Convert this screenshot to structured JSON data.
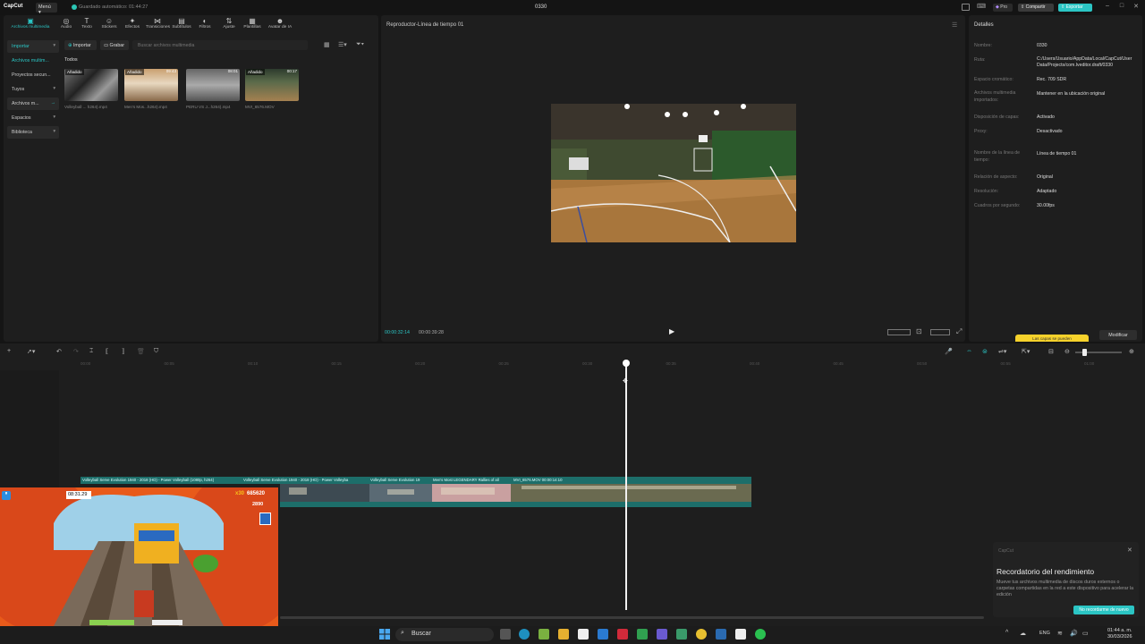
{
  "titlebar": {
    "logo": "CapCut",
    "menu": "Menú",
    "autosave": "Guardado automático: 01:44:27",
    "project_title": "0330",
    "pro": "Pro",
    "share": "Compartir",
    "export": "Exportar"
  },
  "media_panel": {
    "tools": [
      {
        "label": "Archivos multimedia",
        "icon": "media-icon"
      },
      {
        "label": "Audio",
        "icon": "audio-icon"
      },
      {
        "label": "Texto",
        "icon": "text-icon"
      },
      {
        "label": "Stickers",
        "icon": "sticker-icon"
      },
      {
        "label": "Efectos",
        "icon": "effects-icon"
      },
      {
        "label": "Transiciones",
        "icon": "transitions-icon"
      },
      {
        "label": "Subtítulos",
        "icon": "subtitles-icon"
      },
      {
        "label": "Filtros",
        "icon": "filters-icon"
      },
      {
        "label": "Ajuste",
        "icon": "adjust-icon"
      },
      {
        "label": "Plantillas",
        "icon": "templates-icon"
      },
      {
        "label": "Avatar de IA",
        "icon": "avatar-icon"
      }
    ],
    "nav": [
      {
        "label": "Importar"
      },
      {
        "label": "Archivos multim..."
      },
      {
        "label": "Proyectos secun..."
      },
      {
        "label": "Tuyos"
      },
      {
        "label": "Archivos m..."
      },
      {
        "label": "Espacios"
      },
      {
        "label": "Biblioteca"
      }
    ],
    "import_btn": "Importar",
    "record_btn": "Grabar",
    "search_placeholder": "Buscar archivos multimedia",
    "section_title": "Todos",
    "items": [
      {
        "badge": "Añadido",
        "duration": "",
        "name": "Volleyball ... h264).mp4"
      },
      {
        "badge": "Añadido",
        "duration": "09:43",
        "name": "Men's Mos...h264).mp4"
      },
      {
        "badge": "",
        "duration": "08:01",
        "name": "PERU VS J...h264).mp4"
      },
      {
        "badge": "Añadido",
        "duration": "00:17",
        "name": "MVI_6576.MOV"
      }
    ]
  },
  "player": {
    "title": "Reproductor-Línea de tiempo 01",
    "current_time": "00:00:32:14",
    "total_time": "00:00:39:28"
  },
  "details": {
    "title": "Detalles",
    "rows": [
      {
        "label": "Nombre:",
        "value": "0330"
      },
      {
        "label": "Ruta:",
        "value": "C:/Users/Usuario/AppData/Local/CapCut/User Data/Projects/com.lveditor.draft/0330"
      },
      {
        "label": "Espacio cromático:",
        "value": "Rec. 709 SDR"
      },
      {
        "label": "Archivos multimedia importados:",
        "value": "Mantener en la ubicación original"
      },
      {
        "label": "Disposición de capas:",
        "value": "Activado"
      },
      {
        "label": "Proxy:",
        "value": "Desactivado"
      },
      {
        "label": "Nombre de la línea de tiempo:",
        "value": "Línea de tiempo 01"
      },
      {
        "label": "Relación de aspecto:",
        "value": "Original"
      },
      {
        "label": "Resolución:",
        "value": "Adaptado"
      },
      {
        "label": "Cuadros por segundo:",
        "value": "30.00fps"
      }
    ],
    "tip": "Las capas se pueden",
    "modify": "Modificar"
  },
  "timeline": {
    "ticks": [
      "00:00",
      "00:05",
      "00:10",
      "00:15",
      "00:20",
      "00:25",
      "00:30",
      "00:35",
      "00:40",
      "00:45",
      "00:50",
      "00:55",
      "01:00",
      "01:05"
    ],
    "clips": [
      "Volleyball Serve Evolution 1940 - 2018 (HD) - Power Volleyball (1080p, h264)",
      "Volleyball Serve Evolution 1940 - 2018 (HD) - Power Volleyba",
      "Volleyball Serve Evolution 19",
      "Men's Most LEGENDARY Rallies of all",
      "MVI_6576.MOV   00:00:14:10"
    ]
  },
  "game": {
    "time": "08:31.29",
    "multiplier": "x30",
    "score": "685620",
    "coins": "2890"
  },
  "toast": {
    "app": "CapCut",
    "title": "Recordatorio del rendimiento",
    "body": "Mueve tus archivos multimedia de discos duros externos o carpetas compartidas en la red a este dispositivo para acelerar la edición",
    "button": "No recordarme de nuevo"
  },
  "taskbar": {
    "search": "Buscar",
    "lang": "ENG",
    "time": "01:44 a. m.",
    "date": "30/03/2026"
  },
  "colors": {
    "accent": "#2bc5c4",
    "track": "#1d6e6a",
    "tip": "#f6d22b"
  }
}
